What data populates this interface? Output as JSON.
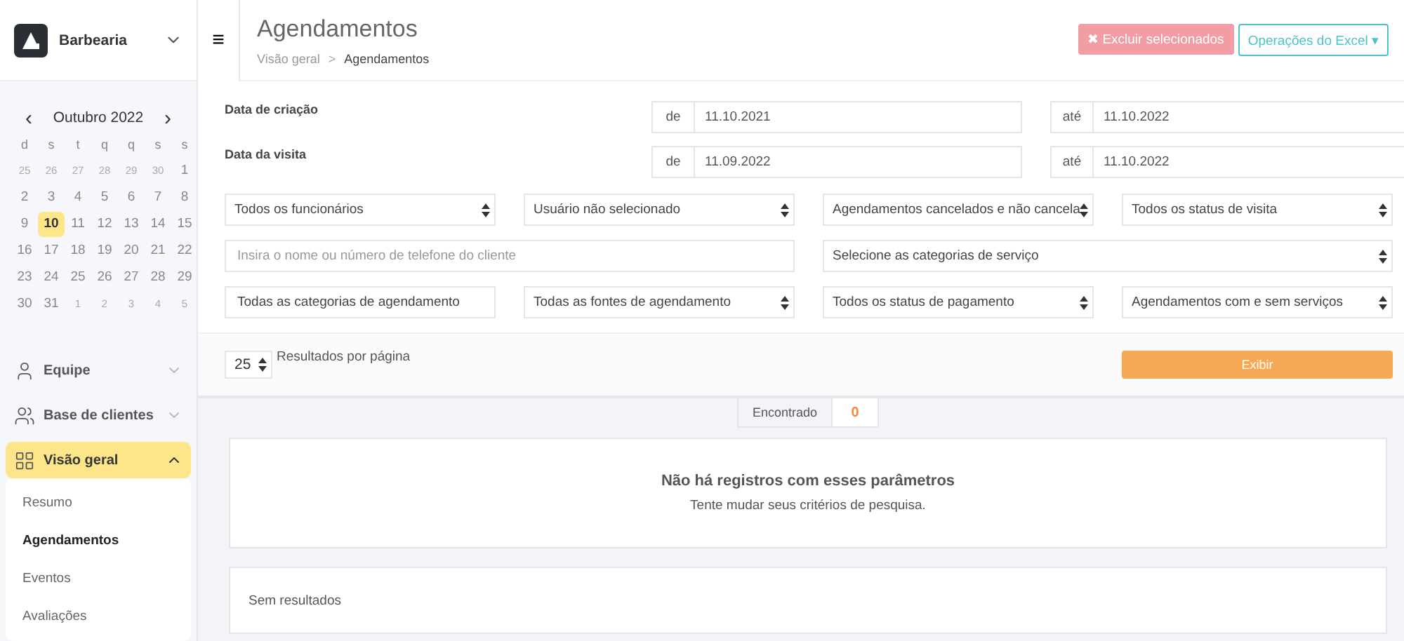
{
  "brand": {
    "name": "Barbearia"
  },
  "calendar": {
    "month": "Outubro 2022",
    "prev": "‹",
    "next": "›",
    "weekdays": [
      "d",
      "s",
      "t",
      "q",
      "q",
      "s",
      "s"
    ],
    "days": [
      {
        "label": "25",
        "outside": true,
        "selected": false
      },
      {
        "label": "26",
        "outside": true,
        "selected": false
      },
      {
        "label": "27",
        "outside": true,
        "selected": false
      },
      {
        "label": "28",
        "outside": true,
        "selected": false
      },
      {
        "label": "29",
        "outside": true,
        "selected": false
      },
      {
        "label": "30",
        "outside": true,
        "selected": false
      },
      {
        "label": "1",
        "outside": false,
        "selected": false
      },
      {
        "label": "2",
        "outside": false,
        "selected": false
      },
      {
        "label": "3",
        "outside": false,
        "selected": false
      },
      {
        "label": "4",
        "outside": false,
        "selected": false
      },
      {
        "label": "5",
        "outside": false,
        "selected": false
      },
      {
        "label": "6",
        "outside": false,
        "selected": false
      },
      {
        "label": "7",
        "outside": false,
        "selected": false
      },
      {
        "label": "8",
        "outside": false,
        "selected": false
      },
      {
        "label": "9",
        "outside": false,
        "selected": false
      },
      {
        "label": "10",
        "outside": false,
        "selected": true
      },
      {
        "label": "11",
        "outside": false,
        "selected": false
      },
      {
        "label": "12",
        "outside": false,
        "selected": false
      },
      {
        "label": "13",
        "outside": false,
        "selected": false
      },
      {
        "label": "14",
        "outside": false,
        "selected": false
      },
      {
        "label": "15",
        "outside": false,
        "selected": false
      },
      {
        "label": "16",
        "outside": false,
        "selected": false
      },
      {
        "label": "17",
        "outside": false,
        "selected": false
      },
      {
        "label": "18",
        "outside": false,
        "selected": false
      },
      {
        "label": "19",
        "outside": false,
        "selected": false
      },
      {
        "label": "20",
        "outside": false,
        "selected": false
      },
      {
        "label": "21",
        "outside": false,
        "selected": false
      },
      {
        "label": "22",
        "outside": false,
        "selected": false
      },
      {
        "label": "23",
        "outside": false,
        "selected": false
      },
      {
        "label": "24",
        "outside": false,
        "selected": false
      },
      {
        "label": "25",
        "outside": false,
        "selected": false
      },
      {
        "label": "26",
        "outside": false,
        "selected": false
      },
      {
        "label": "27",
        "outside": false,
        "selected": false
      },
      {
        "label": "28",
        "outside": false,
        "selected": false
      },
      {
        "label": "29",
        "outside": false,
        "selected": false
      },
      {
        "label": "30",
        "outside": false,
        "selected": false
      },
      {
        "label": "31",
        "outside": false,
        "selected": false
      },
      {
        "label": "1",
        "outside": true,
        "selected": false
      },
      {
        "label": "2",
        "outside": true,
        "selected": false
      },
      {
        "label": "3",
        "outside": true,
        "selected": false
      },
      {
        "label": "4",
        "outside": true,
        "selected": false
      },
      {
        "label": "5",
        "outside": true,
        "selected": false
      }
    ]
  },
  "nav": [
    {
      "label": "Equipe",
      "expanded": false,
      "selected": false
    },
    {
      "label": "Base de clientes",
      "expanded": false,
      "selected": false
    },
    {
      "label": "Visão geral",
      "expanded": true,
      "selected": true,
      "children": [
        {
          "label": "Resumo",
          "selected": false
        },
        {
          "label": "Agendamentos",
          "selected": true
        },
        {
          "label": "Eventos",
          "selected": false
        },
        {
          "label": "Avaliações",
          "selected": false
        }
      ]
    }
  ],
  "header": {
    "menu": "≡",
    "title": "Agendamentos",
    "breadcrumb": [
      "Visão geral",
      "Agendamentos"
    ],
    "separator": ">",
    "delete_button": {
      "icon": "✖",
      "label": "Excluir selecionados"
    },
    "excel_button": {
      "label": "Operações do Excel",
      "caret": "▾"
    }
  },
  "date_filters": [
    {
      "label": "Data de criação",
      "from_prefix": "de",
      "from": "11.10.2021",
      "to_prefix": "até",
      "to": "11.10.2022"
    },
    {
      "label": "Data da visita",
      "from_prefix": "de",
      "from": "11.09.2022",
      "to_prefix": "até",
      "to": "11.10.2022"
    }
  ],
  "filters": [
    {
      "kind": "select",
      "value": "Todos os funcionários"
    },
    {
      "kind": "select",
      "value": "Usuário não selecionado"
    },
    {
      "kind": "select",
      "value": "Agendamentos cancelados e não cancela"
    },
    {
      "kind": "select",
      "value": "Todos os status de visita"
    },
    {
      "kind": "input",
      "placeholder": "Insira o nome ou número de telefone do cliente"
    },
    {
      "kind": "wide_select",
      "value": "Selecione as categorias de serviço"
    },
    {
      "kind": "button",
      "value": "Todas as categorias de agendamento"
    },
    {
      "kind": "select",
      "value": "Todas as fontes de agendamento"
    },
    {
      "kind": "select",
      "value": "Todos os status de pagamento"
    },
    {
      "kind": "select",
      "value": "Agendamentos com e sem serviços"
    }
  ],
  "pagination": {
    "per_page": "25",
    "label": "Resultados por página"
  },
  "show_button": "Exibir",
  "found": {
    "label": "Encontrado",
    "count": "0"
  },
  "empty_state": {
    "title": "Não há registros com esses parâmetros",
    "subtitle": "Tente mudar seus critérios de pesquisa."
  },
  "results": {
    "text": "Sem resultados"
  }
}
